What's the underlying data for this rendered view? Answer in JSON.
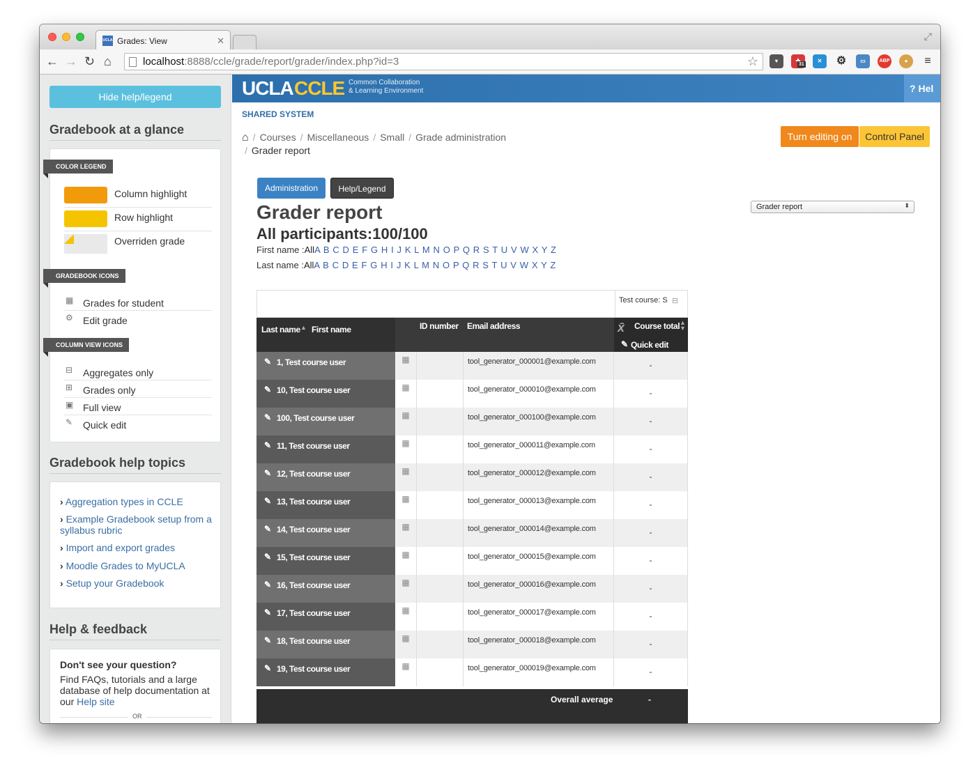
{
  "browser": {
    "tab_title": "Grades: View",
    "tab_favicon": "UCLA",
    "url_domain": "localhost",
    "url_rest": ":8888/ccle/grade/report/grader/index.php?id=3",
    "ext_badge": "31",
    "ext_abp": "ABP",
    "icons": [
      "back-arrow-icon",
      "forward-arrow-icon",
      "reload-icon",
      "home-icon",
      "bookmark-star-icon",
      "pocket-icon",
      "calendar-icon",
      "bird-icon",
      "gear-icon",
      "screen-icon",
      "adblock-icon",
      "cookie-icon",
      "menu-icon"
    ]
  },
  "sidebar": {
    "hide_button": "Hide help/legend",
    "glance_title": "Gradebook at a glance",
    "color_legend_label": "COLOR LEGEND",
    "colors": [
      {
        "label": "Column highlight",
        "color": "#f29b0a"
      },
      {
        "label": "Row highlight",
        "color": "#f5c400"
      },
      {
        "label": "Overriden grade",
        "color": "#f5c400"
      }
    ],
    "gradebook_icons_label": "GRADEBOOK ICONS",
    "gradebook_icons": [
      {
        "label": "Grades for student",
        "icon": "grid-icon"
      },
      {
        "label": "Edit grade",
        "icon": "gear-icon"
      }
    ],
    "column_view_label": "COLUMN VIEW ICONS",
    "column_view_icons": [
      {
        "label": "Aggregates only",
        "icon": "minus-box-icon"
      },
      {
        "label": "Grades only",
        "icon": "plus-box-icon"
      },
      {
        "label": "Full view",
        "icon": "window-icon"
      },
      {
        "label": "Quick edit",
        "icon": "pencil-icon"
      }
    ],
    "help_topics_title": "Gradebook help topics",
    "help_links": [
      "Aggregation types in CCLE",
      "Example Gradebook setup from a syllabus rubric",
      "Import and export grades",
      "Moodle Grades to MyUCLA",
      "Setup your Gradebook"
    ],
    "feedback_title": "Help & feedback",
    "feedback_question": "Don't see your question?",
    "feedback_text": "Find FAQs, tutorials and a large database of help documentation at our",
    "feedback_link": "Help site",
    "or_label": "OR"
  },
  "header": {
    "logo_ucla": "UCLA",
    "logo_ccle": "CCLE",
    "logo_sub1": "Common Collaboration",
    "logo_sub2": "& Learning Environment",
    "help_label": "Hel",
    "shared_system": "SHARED SYSTEM"
  },
  "breadcrumb": {
    "items": [
      "Courses",
      "Miscellaneous",
      "Small",
      "Grade administration"
    ],
    "current": "Grader report"
  },
  "actions": {
    "editing": "Turn editing on",
    "control_panel": "Control Panel"
  },
  "report": {
    "tab_admin": "Administration",
    "tab_help": "Help/Legend",
    "title": "Grader report",
    "participants": "All participants:100/100",
    "select_value": "Grader report",
    "firstname_label": "First name :",
    "lastname_label": "Last name :",
    "all_label": "All",
    "letters": "A B C D E F G H I J K L M N O P Q R S T U V W X Y Z"
  },
  "grid": {
    "category_header": "Test course: S",
    "col_lastname": "Last name",
    "col_firstname": "First name",
    "col_idnumber": "ID number",
    "col_email": "Email address",
    "col_total": "Course total",
    "quick_edit": "Quick edit",
    "overall_average": "Overall average",
    "overall_value": "-",
    "rows": [
      {
        "name": "1, Test course user",
        "email": "tool_generator_000001@example.com",
        "grade": "-"
      },
      {
        "name": "10, Test course user",
        "email": "tool_generator_000010@example.com",
        "grade": "-"
      },
      {
        "name": "100, Test course user",
        "email": "tool_generator_000100@example.com",
        "grade": "-"
      },
      {
        "name": "11, Test course user",
        "email": "tool_generator_000011@example.com",
        "grade": "-"
      },
      {
        "name": "12, Test course user",
        "email": "tool_generator_000012@example.com",
        "grade": "-"
      },
      {
        "name": "13, Test course user",
        "email": "tool_generator_000013@example.com",
        "grade": "-"
      },
      {
        "name": "14, Test course user",
        "email": "tool_generator_000014@example.com",
        "grade": "-"
      },
      {
        "name": "15, Test course user",
        "email": "tool_generator_000015@example.com",
        "grade": "-"
      },
      {
        "name": "16, Test course user",
        "email": "tool_generator_000016@example.com",
        "grade": "-"
      },
      {
        "name": "17, Test course user",
        "email": "tool_generator_000017@example.com",
        "grade": "-"
      },
      {
        "name": "18, Test course user",
        "email": "tool_generator_000018@example.com",
        "grade": "-"
      },
      {
        "name": "19, Test course user",
        "email": "tool_generator_000019@example.com",
        "grade": "-"
      }
    ]
  }
}
